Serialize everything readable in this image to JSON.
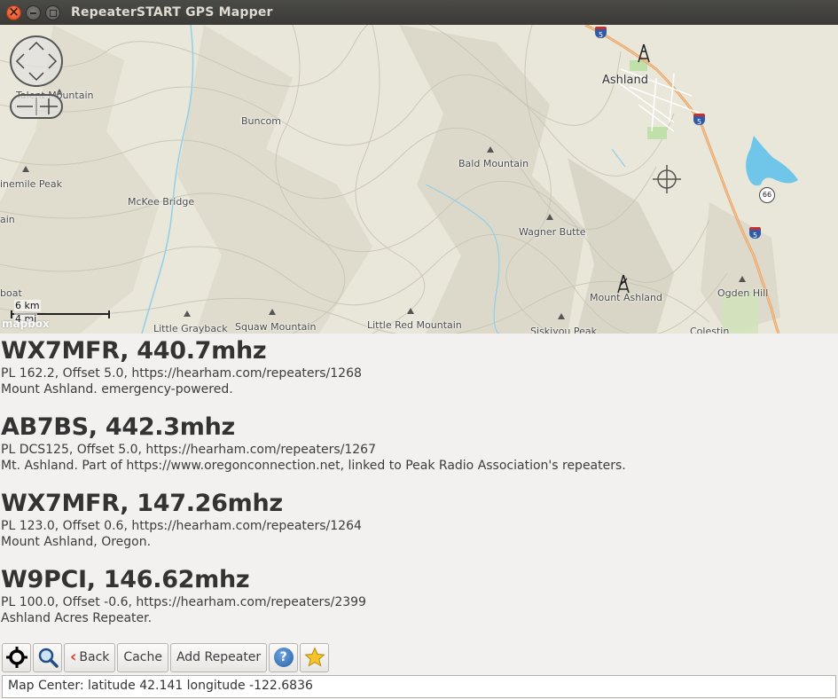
{
  "window": {
    "title": "RepeaterSTART GPS Mapper"
  },
  "map": {
    "labels": {
      "talent_mountain": "Talent Mountain",
      "buncom": "Buncom",
      "ashland": "Ashland",
      "bald_mountain": "Bald Mountain",
      "mckee_bridge": "McKee Bridge",
      "ninemile_peak": "inemile Peak",
      "wagner_butte": "Wagner Butte",
      "ain": "ain",
      "mount_ashland": "Mount Ashland",
      "ogden_hill": "Ogden Hill",
      "boat": "boat",
      "little_grayback": "Little Grayback",
      "squaw_mountain": "Squaw Mountain",
      "little_red_mountain": "Little Red Mountain",
      "siskiyou_peak": "Siskiyou Peak",
      "colestin": "Colestin"
    },
    "shields": {
      "i5_a": "5",
      "i5_b": "5",
      "i5_c": "5",
      "or66": "66"
    },
    "scale_km": "6 km",
    "scale_mi": "4 mi",
    "attribution": "mapbox"
  },
  "repeaters": [
    {
      "title": "WX7MFR, 440.7mhz",
      "details": "PL 162.2, Offset 5.0, https://hearham.com/repeaters/1268",
      "description": "Mount Ashland. emergency-powered."
    },
    {
      "title": "AB7BS, 442.3mhz",
      "details": "PL DCS125, Offset 5.0, https://hearham.com/repeaters/1267",
      "description": "Mt. Ashland. Part of https://www.oregonconnection.net, linked to Peak Radio Association's repeaters."
    },
    {
      "title": "WX7MFR, 147.26mhz",
      "details": "PL 123.0, Offset 0.6, https://hearham.com/repeaters/1264",
      "description": "Mount Ashland, Oregon."
    },
    {
      "title": "W9PCI, 146.62mhz",
      "details": "PL 100.0, Offset -0.6, https://hearham.com/repeaters/2399",
      "description": "Ashland Acres Repeater."
    }
  ],
  "toolbar": {
    "back_label": "Back",
    "cache_label": "Cache",
    "add_repeater_label": "Add Repeater",
    "help_icon_text": "?"
  },
  "status": {
    "text": "Map Center: latitude 42.141 longitude -122.6836"
  },
  "colors": {
    "titlebar": "#3c3b37",
    "map_background": "#e9e6da",
    "water": "#6fc6e9",
    "highway": "#e8a66b",
    "window_background": "#f2f1f0"
  }
}
